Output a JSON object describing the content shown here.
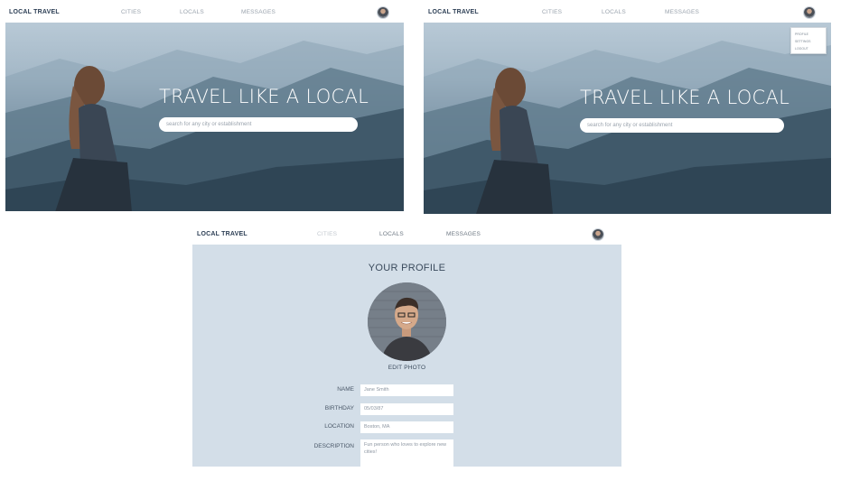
{
  "nav": {
    "brand": "LOCAL TRAVEL",
    "links": [
      "CITIES",
      "LOCALS",
      "MESSAGES"
    ]
  },
  "hero": {
    "title": "TRAVEL LIKE A LOCAL",
    "search_placeholder": "search for any city or establishment"
  },
  "dropdown": {
    "items": [
      "PROFILE",
      "SETTINGS",
      "LOGOUT"
    ]
  },
  "profile": {
    "title": "YOUR PROFILE",
    "edit_photo": "EDIT PHOTO",
    "fields": [
      {
        "label": "NAME",
        "value": "Jane Smith"
      },
      {
        "label": "BIRTHDAY",
        "value": "05/03/87"
      },
      {
        "label": "LOCATION",
        "value": "Boston, MA"
      },
      {
        "label": "DESCRIPTION",
        "value": "Fun person who loves to explore new cities!"
      }
    ]
  },
  "colors": {
    "brand": "#2d3f55",
    "nav_link": "#9aa3ad",
    "profile_bg": "#d3dee8"
  }
}
